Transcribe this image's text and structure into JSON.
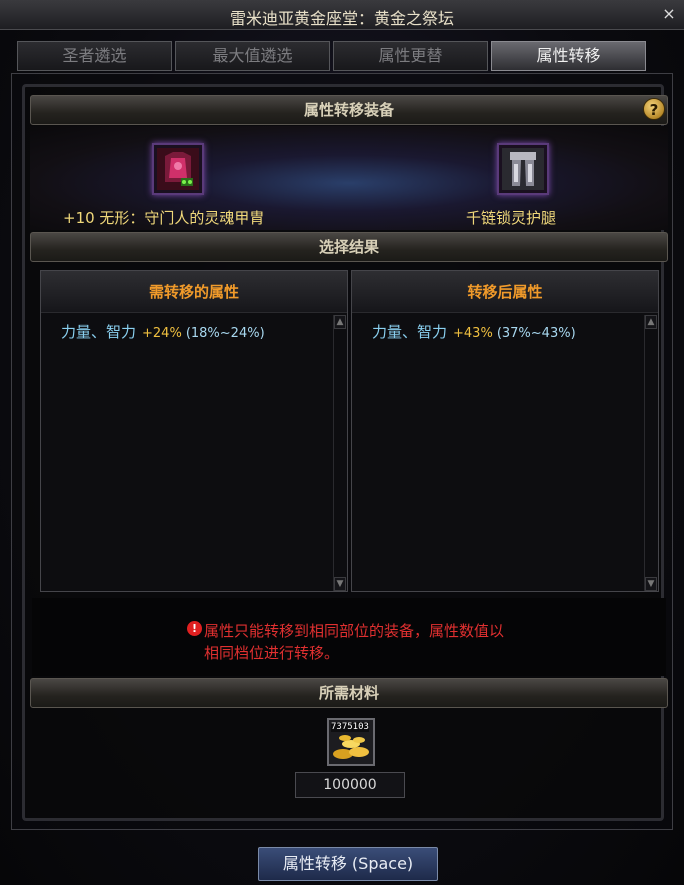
{
  "window": {
    "title": "雷米迪亚黄金座堂：黄金之祭坛",
    "close_glyph": "×"
  },
  "tabs": [
    {
      "label": "圣者遴选",
      "active": false
    },
    {
      "label": "最大值遴选",
      "active": false
    },
    {
      "label": "属性更替",
      "active": false
    },
    {
      "label": "属性转移",
      "active": true
    }
  ],
  "equip_section": {
    "header": "属性转移装备",
    "help_glyph": "?",
    "source_item": {
      "name": "+10 无形：守门人的灵魂甲胄",
      "icon": "chest-armor-icon"
    },
    "target_item": {
      "name": "千链锁灵护腿",
      "icon": "leg-armor-icon"
    }
  },
  "result_section": {
    "header": "选择结果",
    "left_panel": {
      "title": "需转移的属性",
      "stat_name": "力量、智力",
      "stat_value": "+24%",
      "stat_range": "(18%~24%)"
    },
    "right_panel": {
      "title": "转移后属性",
      "stat_name": "力量、智力",
      "stat_value": "+43%",
      "stat_range": "(37%~43%)"
    }
  },
  "warning": {
    "icon_glyph": "!",
    "line1": "属性只能转移到相同部位的装备，属性数值以",
    "line2": "相同档位进行转移。"
  },
  "materials": {
    "header": "所需材料",
    "item_count": "7375103",
    "item_icon": "gold-coins-icon",
    "quantity": "100000"
  },
  "action_button": {
    "label": "属性转移 (Space)"
  },
  "colors": {
    "stat_name": "#8ad0f0",
    "stat_value": "#f0c040",
    "equip_name": "#f0d87a",
    "warning": "#e03030",
    "panel_title": "#f09a2a"
  }
}
